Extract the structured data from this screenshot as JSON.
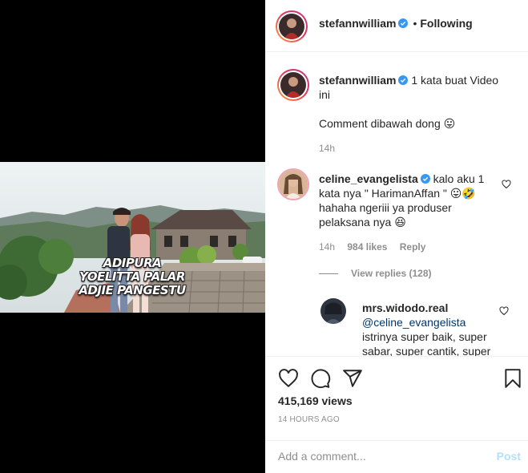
{
  "media": {
    "caption_lines": [
      "ADIPURA",
      "YOELITTA PALAR",
      "ADJIE PANGESTU"
    ]
  },
  "header": {
    "username": "stefannwilliam",
    "separator": "•",
    "follow_status": "Following",
    "verified_icon": "verified-badge-icon"
  },
  "caption": {
    "username": "stefannwilliam",
    "text_line1": "1 kata buat Video",
    "text_line2": "ini",
    "text_line3": "Comment dibawah dong",
    "emoji": "😛",
    "time": "14h"
  },
  "comment1": {
    "username": "celine_evangelista",
    "text_a": "kalo aku 1",
    "text_b": "kata nya \" HarimanAffan \"",
    "emoji_a": "😛",
    "emoji_b": "🤣",
    "text_c": "hahaha ngeriii ya produser",
    "text_d": "pelaksana nya",
    "emoji_c": "😆",
    "time": "14h",
    "likes": "984 likes",
    "reply": "Reply",
    "view_replies": "View replies (128)"
  },
  "reply1": {
    "username": "mrs.widodo.real",
    "mention": "@celine_evangelista",
    "text_a": "istrinya super baik, super",
    "text_b": "sabar, super cantik, super"
  },
  "actions": {
    "views": "415,169 views",
    "time_ago": "14 HOURS AGO"
  },
  "add_comment": {
    "placeholder": "Add a comment...",
    "post": "Post"
  },
  "colors": {
    "verified": "#3897f0",
    "link": "#00376b",
    "muted": "#8e8e8e",
    "post_disabled": "#b2dffc"
  }
}
